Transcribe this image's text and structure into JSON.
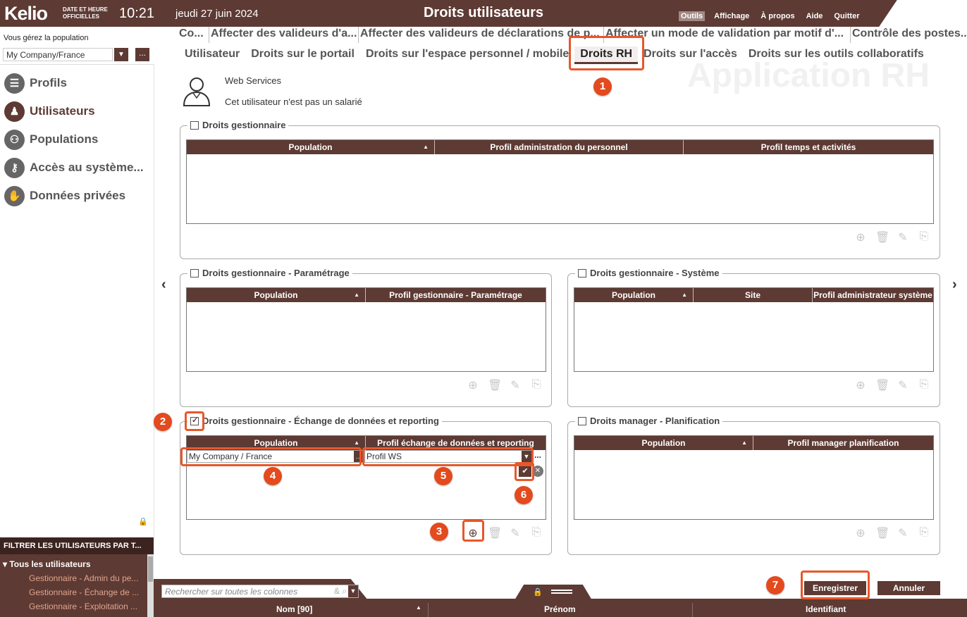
{
  "header": {
    "logo": "Kelio",
    "datetime_label_1": "DATE ET HEURE",
    "datetime_label_2": "OFFICIELLES",
    "time": "10:21",
    "date": "jeudi 27 juin 2024",
    "title": "Droits utilisateurs",
    "menu": [
      "Outils",
      "Affichage",
      "À propos",
      "Aide",
      "Quitter"
    ],
    "menu_active": "Outils"
  },
  "left": {
    "population_label": "Vous gérez la population",
    "population_value": "My Company/France",
    "more": "...",
    "nav": [
      {
        "label": "Profils",
        "icon": "profiles-icon"
      },
      {
        "label": "Utilisateurs",
        "icon": "user-icon"
      },
      {
        "label": "Populations",
        "icon": "populations-icon"
      },
      {
        "label": "Accès au système...",
        "icon": "key-icon"
      },
      {
        "label": "Données privées",
        "icon": "hand-stop-icon"
      }
    ],
    "filter_title": "FILTRER LES UTILISATEURS PAR T...",
    "filter_root": "Tous les utilisateurs",
    "filter_children": [
      "Gestionnaire - Admin du pe...",
      "Gestionnaire - Échange de ...",
      "Gestionnaire - Exploitation ..."
    ]
  },
  "tabs_row1": [
    "Co...",
    "Affecter des valideurs d'a...",
    "Affecter des valideurs de déclarations de p...",
    "Affecter un mode de validation par motif d'...",
    "Contrôle des postes..."
  ],
  "tabs_row2": [
    "Utilisateur",
    "Droits sur le portail",
    "Droits sur l'espace personnel / mobile",
    "Droits RH",
    "Droits sur l'accès",
    "Droits sur les outils collaboratifs"
  ],
  "tab_active": "Droits RH",
  "watermark": "Application RH",
  "employee": {
    "name": "Web Services",
    "note": "Cet utilisateur n'est pas un salarié"
  },
  "groups": {
    "gestionnaire": {
      "title": "Droits gestionnaire",
      "checked": false,
      "columns": [
        "Population",
        "Profil administration du personnel",
        "Profil temps et activités"
      ]
    },
    "parametrage": {
      "title": "Droits gestionnaire - Paramétrage",
      "checked": false,
      "columns": [
        "Population",
        "Profil gestionnaire - Paramétrage"
      ]
    },
    "systeme": {
      "title": "Droits gestionnaire - Système",
      "checked": false,
      "columns": [
        "Population",
        "Site",
        "Profil administrateur système"
      ]
    },
    "echange": {
      "title": "Droits gestionnaire - Échange de données et reporting",
      "checked": true,
      "columns": [
        "Population",
        "Profil échange de données et reporting"
      ],
      "edit_population": "My Company / France",
      "edit_profile": "Profil WS",
      "edit_more": "..."
    },
    "planification": {
      "title": "Droits manager - Planification",
      "checked": false,
      "columns": [
        "Population",
        "Profil manager planification"
      ]
    }
  },
  "annotations": [
    "1",
    "2",
    "3",
    "4",
    "5",
    "6",
    "7"
  ],
  "buttons": {
    "save": "Enregistrer",
    "cancel": "Annuler"
  },
  "search": {
    "placeholder": "Rechercher sur toutes les colonnes"
  },
  "grid_columns": [
    "Nom [90]",
    "Prénom",
    "Identifiant"
  ],
  "colors": {
    "brand": "#5d3a33",
    "highlight": "#e8572a",
    "badge": "#e34a1e"
  }
}
